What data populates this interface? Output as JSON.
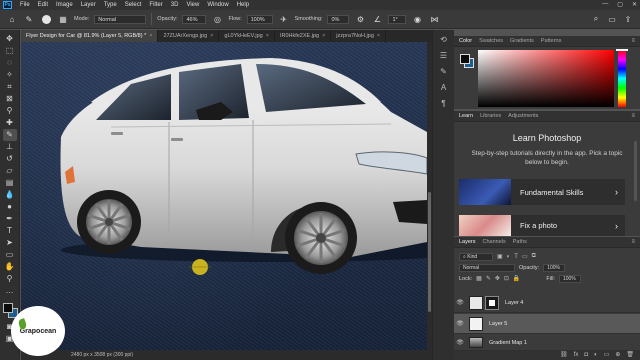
{
  "app": {
    "logo": "Ps"
  },
  "menu": [
    "File",
    "Edit",
    "Image",
    "Layer",
    "Type",
    "Select",
    "Filter",
    "3D",
    "View",
    "Window",
    "Help"
  ],
  "options_bar": {
    "mode_label": "Mode:",
    "mode_value": "Normal",
    "opacity_label": "Opacity:",
    "opacity_value": "46%",
    "flow_label": "Flow:",
    "flow_value": "100%",
    "smoothing_label": "Smoothing:",
    "smoothing_value": "0%",
    "angle_value": "1°"
  },
  "tabs": [
    {
      "label": "Flyer Design for Car @ 81.9% (Layer 5, RGB/8) *",
      "active": true
    },
    {
      "label": "27ZUArXengp.jpg",
      "active": false
    },
    {
      "label": "gL0YkHeEV.jpg",
      "active": false
    },
    {
      "label": "IR0Hkfe2XE.jpg",
      "active": false
    },
    {
      "label": "jzzpra7NoH.jpg",
      "active": false
    }
  ],
  "status": {
    "doc_info": "2480 px x 3508 px (300 ppi)"
  },
  "colors": {
    "foreground": "#0b0b0b",
    "background": "#1b5d8c",
    "panel": "#3b3b3b",
    "cursor": "#c9b21f"
  },
  "color_panel": {
    "tabs": [
      "Color",
      "Swatches",
      "Gradients",
      "Patterns"
    ]
  },
  "learn_panel": {
    "tabs": [
      "Learn",
      "Libraries",
      "Adjustments"
    ],
    "title": "Learn Photoshop",
    "description": "Step-by-step tutorials directly in the app. Pick a topic below to begin.",
    "cards": [
      "Fundamental Skills",
      "Fix a photo"
    ]
  },
  "layers_panel": {
    "tabs": [
      "Layers",
      "Channels",
      "Paths"
    ],
    "kind_label": "Kind",
    "blend_mode": "Normal",
    "opacity_label": "Opacity:",
    "opacity_value": "100%",
    "lock_label": "Lock:",
    "fill_label": "Fill:",
    "fill_value": "100%",
    "layers": [
      {
        "name": "Layer 4",
        "selected": false,
        "mask": true
      },
      {
        "name": "Layer 5",
        "selected": true,
        "mask": false
      },
      {
        "name": "Gradient Map 1",
        "selected": false,
        "mask": false
      }
    ]
  },
  "watermark": {
    "text": "Grapocean"
  }
}
